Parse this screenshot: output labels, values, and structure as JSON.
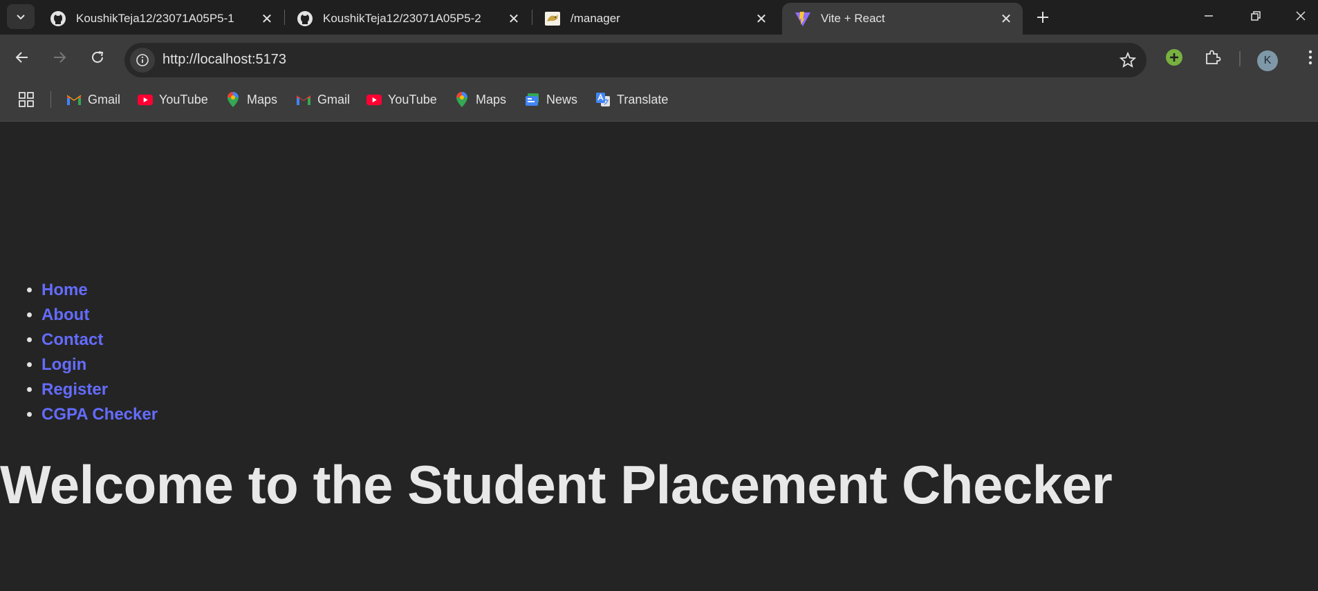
{
  "tabs": [
    {
      "title": "KoushikTeja12/23071A05P5-1",
      "icon": "github-icon"
    },
    {
      "title": "KoushikTeja12/23071A05P5-2",
      "icon": "github-icon"
    },
    {
      "title": "/manager",
      "icon": "tomcat-icon"
    },
    {
      "title": "Vite + React",
      "icon": "vite-icon",
      "active": true
    }
  ],
  "toolbar": {
    "url": "http://localhost:5173",
    "profile_initial": "K"
  },
  "bookmarks": [
    {
      "label": "Gmail",
      "icon": "gmail-icon"
    },
    {
      "label": "YouTube",
      "icon": "youtube-icon"
    },
    {
      "label": "Maps",
      "icon": "maps-icon"
    },
    {
      "label": "Gmail",
      "icon": "gmail-icon"
    },
    {
      "label": "YouTube",
      "icon": "youtube-icon"
    },
    {
      "label": "Maps",
      "icon": "maps-icon"
    },
    {
      "label": "News",
      "icon": "news-icon"
    },
    {
      "label": "Translate",
      "icon": "translate-icon"
    }
  ],
  "page": {
    "nav": [
      "Home",
      "About",
      "Contact",
      "Login",
      "Register",
      "CGPA Checker"
    ],
    "heading": "Welcome to the Student Placement Checker"
  },
  "colors": {
    "link": "#646cff",
    "page_bg": "#242424",
    "toolbar_bg": "#3c3c3c"
  }
}
